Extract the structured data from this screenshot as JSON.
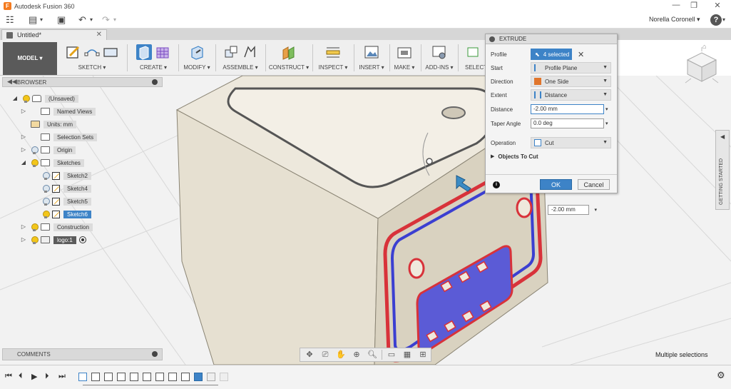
{
  "app": {
    "title": "Autodesk Fusion 360",
    "logo_letter": "F"
  },
  "window": {
    "minimize": "—",
    "restore": "❒",
    "close": "✕"
  },
  "qat": {
    "grid": "☷",
    "file": "▤",
    "save": "▣",
    "undo": "↶",
    "redo": "↷",
    "user": "Norella Coronell ▾",
    "help": "?"
  },
  "doc_tab": {
    "label": "Untitled*",
    "close": "✕"
  },
  "toolbar": {
    "model": "MODEL ▾",
    "groups": [
      "SKETCH ▾",
      "CREATE ▾",
      "MODIFY ▾",
      "ASSEMBLE ▾",
      "CONSTRUCT ▾",
      "INSPECT ▾",
      "INSERT ▾",
      "MAKE ▾",
      "ADD-INS ▾",
      "SELECT"
    ]
  },
  "browser": {
    "header": "BROWSER",
    "collapse": "◀◀",
    "nodes": [
      {
        "label": "(Unsaved)"
      },
      {
        "label": "Named Views"
      },
      {
        "label": "Units: mm"
      },
      {
        "label": "Selection Sets"
      },
      {
        "label": "Origin"
      },
      {
        "label": "Sketches"
      },
      {
        "label": "Sketch2"
      },
      {
        "label": "Sketch4"
      },
      {
        "label": "Sketch5"
      },
      {
        "label": "Sketch6"
      },
      {
        "label": "Construction"
      },
      {
        "label": "logo:1"
      }
    ]
  },
  "comments": {
    "label": "COMMENTS"
  },
  "extrude": {
    "title": "EXTRUDE",
    "profile_label": "Profile",
    "profile_value": "4 selected",
    "start_label": "Start",
    "start_value": "Profile Plane",
    "direction_label": "Direction",
    "direction_value": "One Side",
    "extent_label": "Extent",
    "extent_value": "Distance",
    "distance_label": "Distance",
    "distance_value": "-2.00 mm",
    "taper_label": "Taper Angle",
    "taper_value": "0.0 deg",
    "operation_label": "Operation",
    "operation_value": "Cut",
    "objects_label": "Objects To Cut",
    "ok": "OK",
    "cancel": "Cancel",
    "info": "i"
  },
  "distance_manip": "-2.00 mm",
  "getting_started": "GETTING STARTED",
  "status": "Multiple selections",
  "timeline": {
    "first": "⏮",
    "prev": "⏴",
    "play": "▶",
    "next": "⏵",
    "last": "⏭",
    "settings": "⚙"
  },
  "colors": {
    "accent": "#3d83c7",
    "box": "#e9e3d6",
    "cut_red": "#d8323a",
    "cut_blue": "#3b3fd1"
  }
}
